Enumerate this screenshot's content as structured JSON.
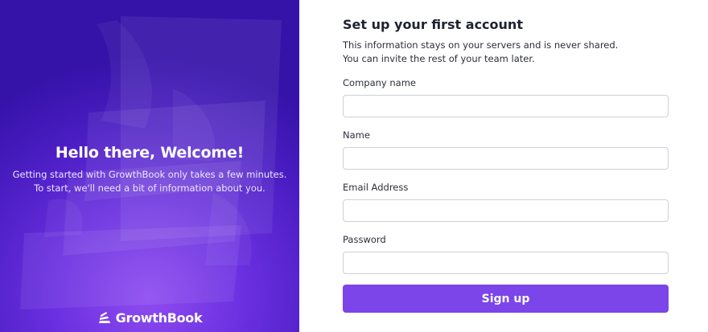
{
  "welcome": {
    "title": "Hello there, Welcome!",
    "line1": "Getting started with GrowthBook only takes a few minutes.",
    "line2": "To start, we'll need a bit of information about you."
  },
  "brand": {
    "name": "GrowthBook",
    "icon": "growthbook-logo-icon"
  },
  "form": {
    "title": "Set up your first account",
    "subtitle_line1": "This information stays on your servers and is never shared.",
    "subtitle_line2": "You can invite the rest of your team later.",
    "fields": [
      {
        "label": "Company name",
        "value": "",
        "placeholder": ""
      },
      {
        "label": "Name",
        "value": "",
        "placeholder": ""
      },
      {
        "label": "Email Address",
        "value": "",
        "placeholder": ""
      },
      {
        "label": "Password",
        "value": "",
        "placeholder": ""
      }
    ],
    "submit_label": "Sign up"
  },
  "colors": {
    "panel_dark": "#3512a8",
    "panel_light": "#8e4cf0",
    "button": "#7b45ea"
  }
}
